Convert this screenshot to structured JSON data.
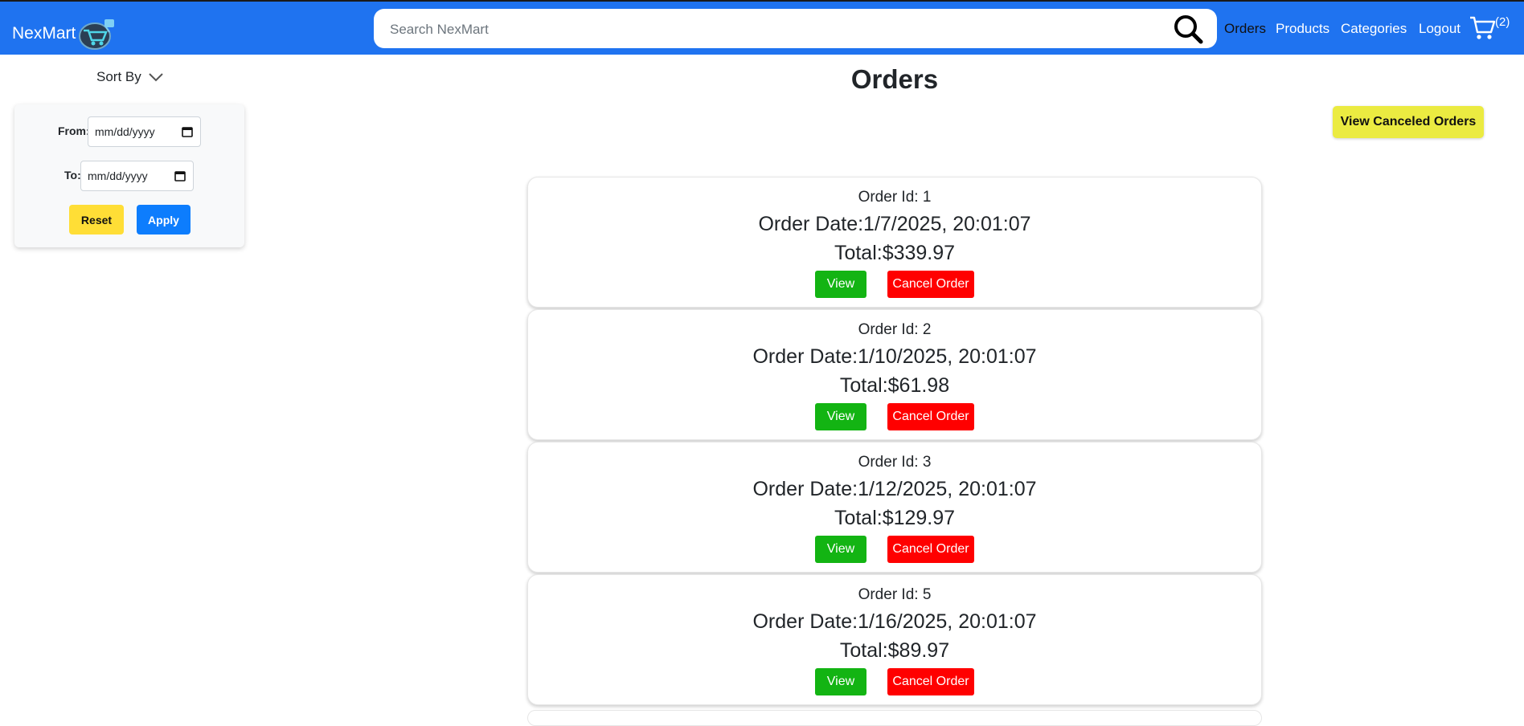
{
  "header": {
    "brand": "NexMart",
    "search_placeholder": "Search NexMart",
    "nav": [
      "Orders",
      "Products",
      "Categories",
      "Logout"
    ],
    "active_nav": "Orders",
    "cart_count": "(2)",
    "color": "#1f73f0"
  },
  "sidebar": {
    "sort_label": "Sort By",
    "from_label": "From:",
    "to_label": "To:",
    "from_value": "mm/dd/yyyy",
    "to_value": "mm/dd/yyyy",
    "reset_label": "Reset",
    "apply_label": "Apply"
  },
  "main": {
    "title": "Orders",
    "view_canceled_label": "View Canceled Orders",
    "orders": [
      {
        "id": "Order Id: 1",
        "date": "Order Date:1/7/2025, 20:01:07",
        "total": "Total:$339.97"
      },
      {
        "id": "Order Id: 2",
        "date": "Order Date:1/10/2025, 20:01:07",
        "total": "Total:$61.98"
      },
      {
        "id": "Order Id: 3",
        "date": "Order Date:1/12/2025, 20:01:07",
        "total": "Total:$129.97"
      },
      {
        "id": "Order Id: 5",
        "date": "Order Date:1/16/2025, 20:01:07",
        "total": "Total:$89.97"
      }
    ],
    "view_label": "View",
    "cancel_label": "Cancel Order"
  }
}
